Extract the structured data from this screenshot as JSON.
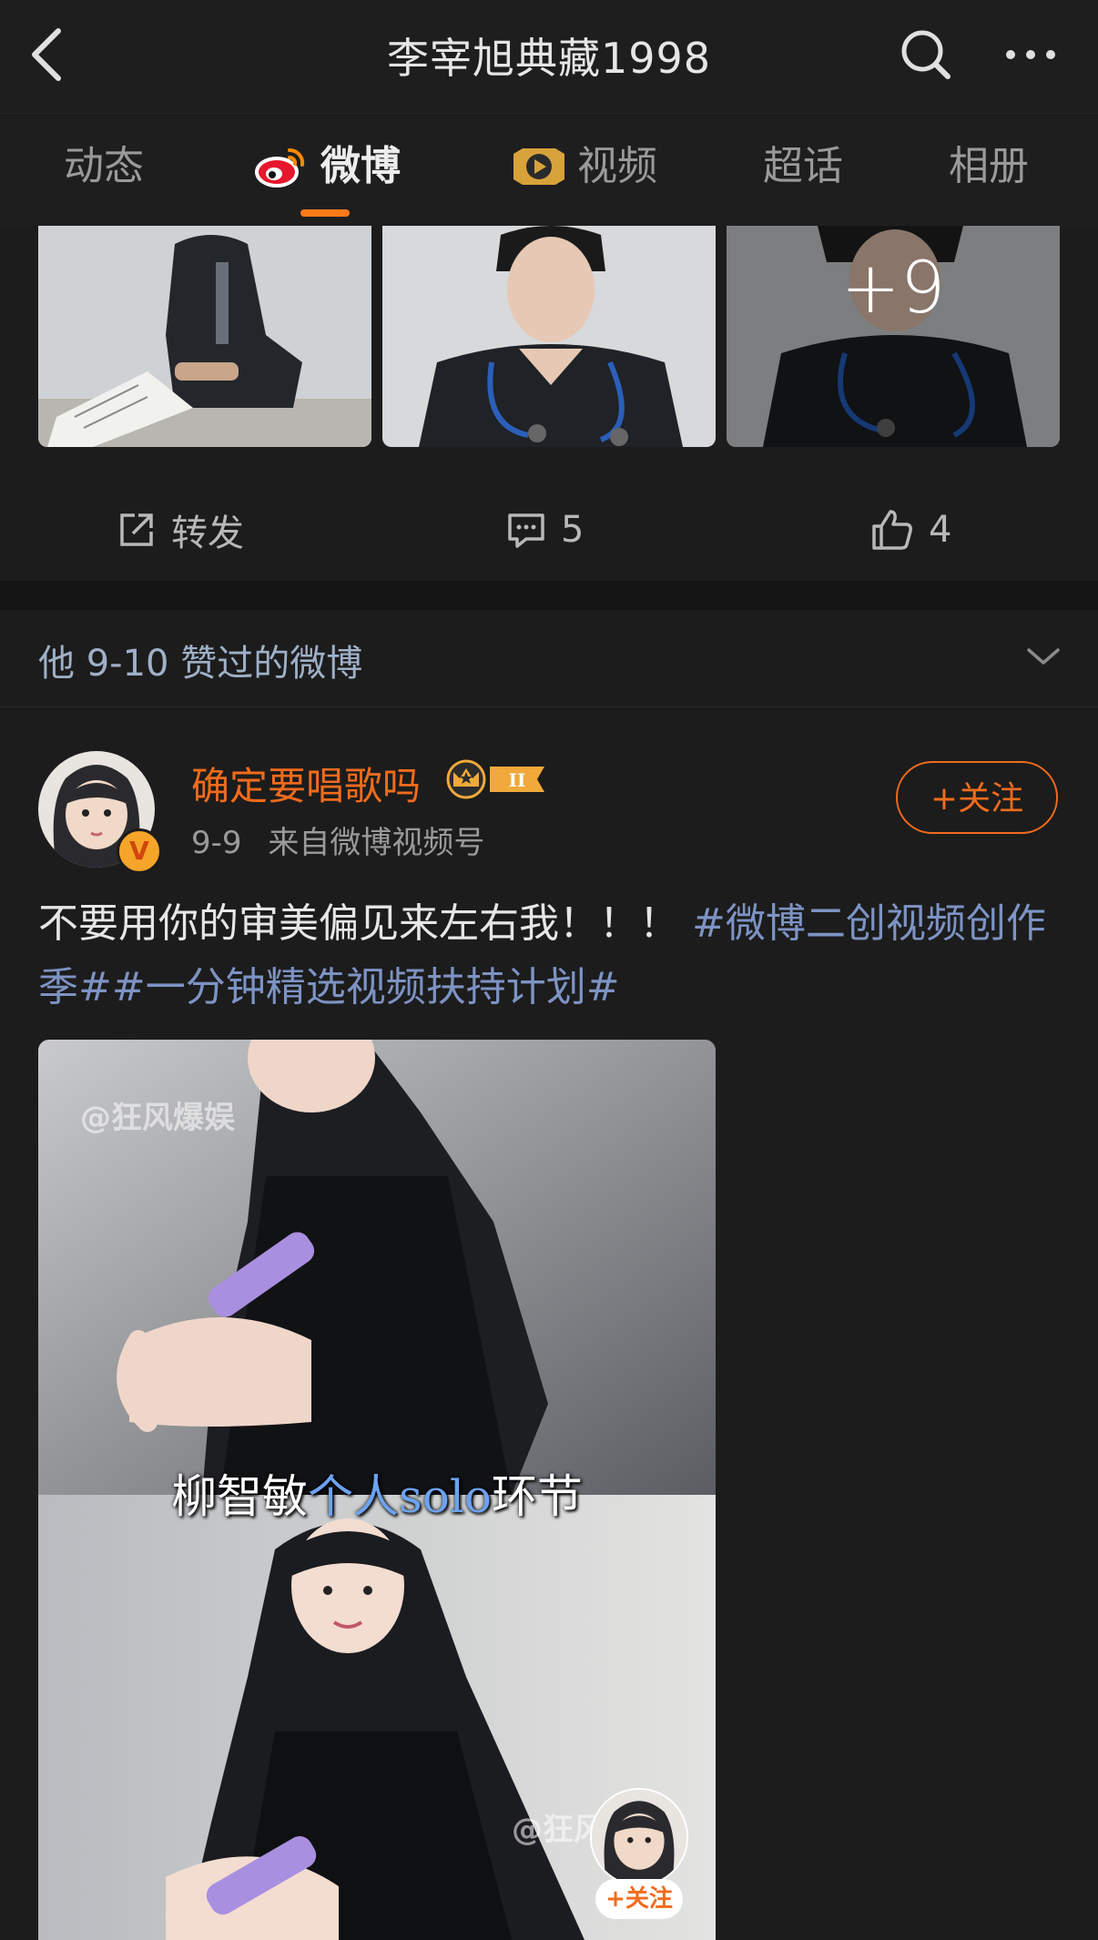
{
  "header": {
    "title": "李宰旭典藏1998"
  },
  "tabs": [
    {
      "label": "动态"
    },
    {
      "label": "微博"
    },
    {
      "label": "视频"
    },
    {
      "label": "超话"
    },
    {
      "label": "相册"
    }
  ],
  "photos": {
    "more_count": "+9"
  },
  "actions": {
    "repost_label": "转发",
    "comment_count": "5",
    "like_count": "4"
  },
  "section": {
    "title": "他 9-10 赞过的微博"
  },
  "post": {
    "username": "确定要唱歌吗",
    "level_badge": "II",
    "verified_mark": "V",
    "date": "9-9",
    "source": "来自微博视频号",
    "follow_label": "+关注",
    "text_plain": "不要用你的审美偏见来左右我！！！",
    "text_hashtags": "#微博二创视频创作季##一分钟精选视频扶持计划#"
  },
  "video": {
    "watermark": "@狂风爆娱",
    "watermark_partial": "@狂风",
    "caption_before": "柳智敏",
    "caption_highlight": "个人solo",
    "caption_after": "环节",
    "mini_follow_label": "+关注"
  },
  "colors": {
    "accent": "#f26b1d",
    "hashtag": "#7d93c4",
    "background": "#1c1c1c"
  }
}
